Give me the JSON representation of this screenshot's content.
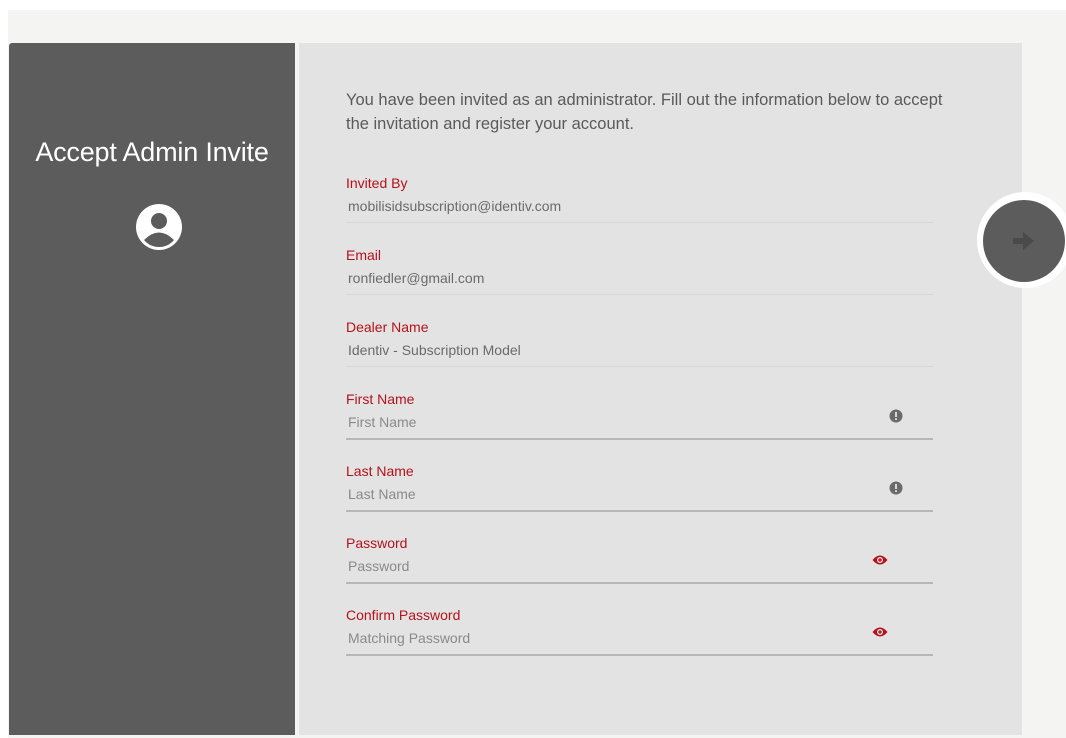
{
  "sidebar": {
    "title": "Accept Admin Invite",
    "icon": "user-circle-icon"
  },
  "intro_text": "You have been invited as an administrator. Fill out the information below to accept the invitation and register your account.",
  "fields": {
    "invited_by": {
      "label": "Invited By",
      "value": "mobilisidsubscription@identiv.com"
    },
    "email": {
      "label": "Email",
      "value": "ronfiedler@gmail.com"
    },
    "dealer_name": {
      "label": "Dealer Name",
      "value": "Identiv - Subscription Model"
    },
    "first_name": {
      "label": "First Name",
      "placeholder": "First Name",
      "icon": "info-circle-icon"
    },
    "last_name": {
      "label": "Last Name",
      "placeholder": "Last Name",
      "icon": "info-circle-icon"
    },
    "password": {
      "label": "Password",
      "placeholder": "Password",
      "icon": "eye-icon"
    },
    "confirm_password": {
      "label": "Confirm Password",
      "placeholder": "Matching Password",
      "icon": "eye-icon"
    }
  },
  "submit": {
    "icon": "arrow-right-icon"
  },
  "colors": {
    "accent": "#b5121b",
    "sidebar_bg": "#5c5c5c",
    "panel_bg": "#e3e3e3",
    "page_bg": "#f4f4f3"
  }
}
